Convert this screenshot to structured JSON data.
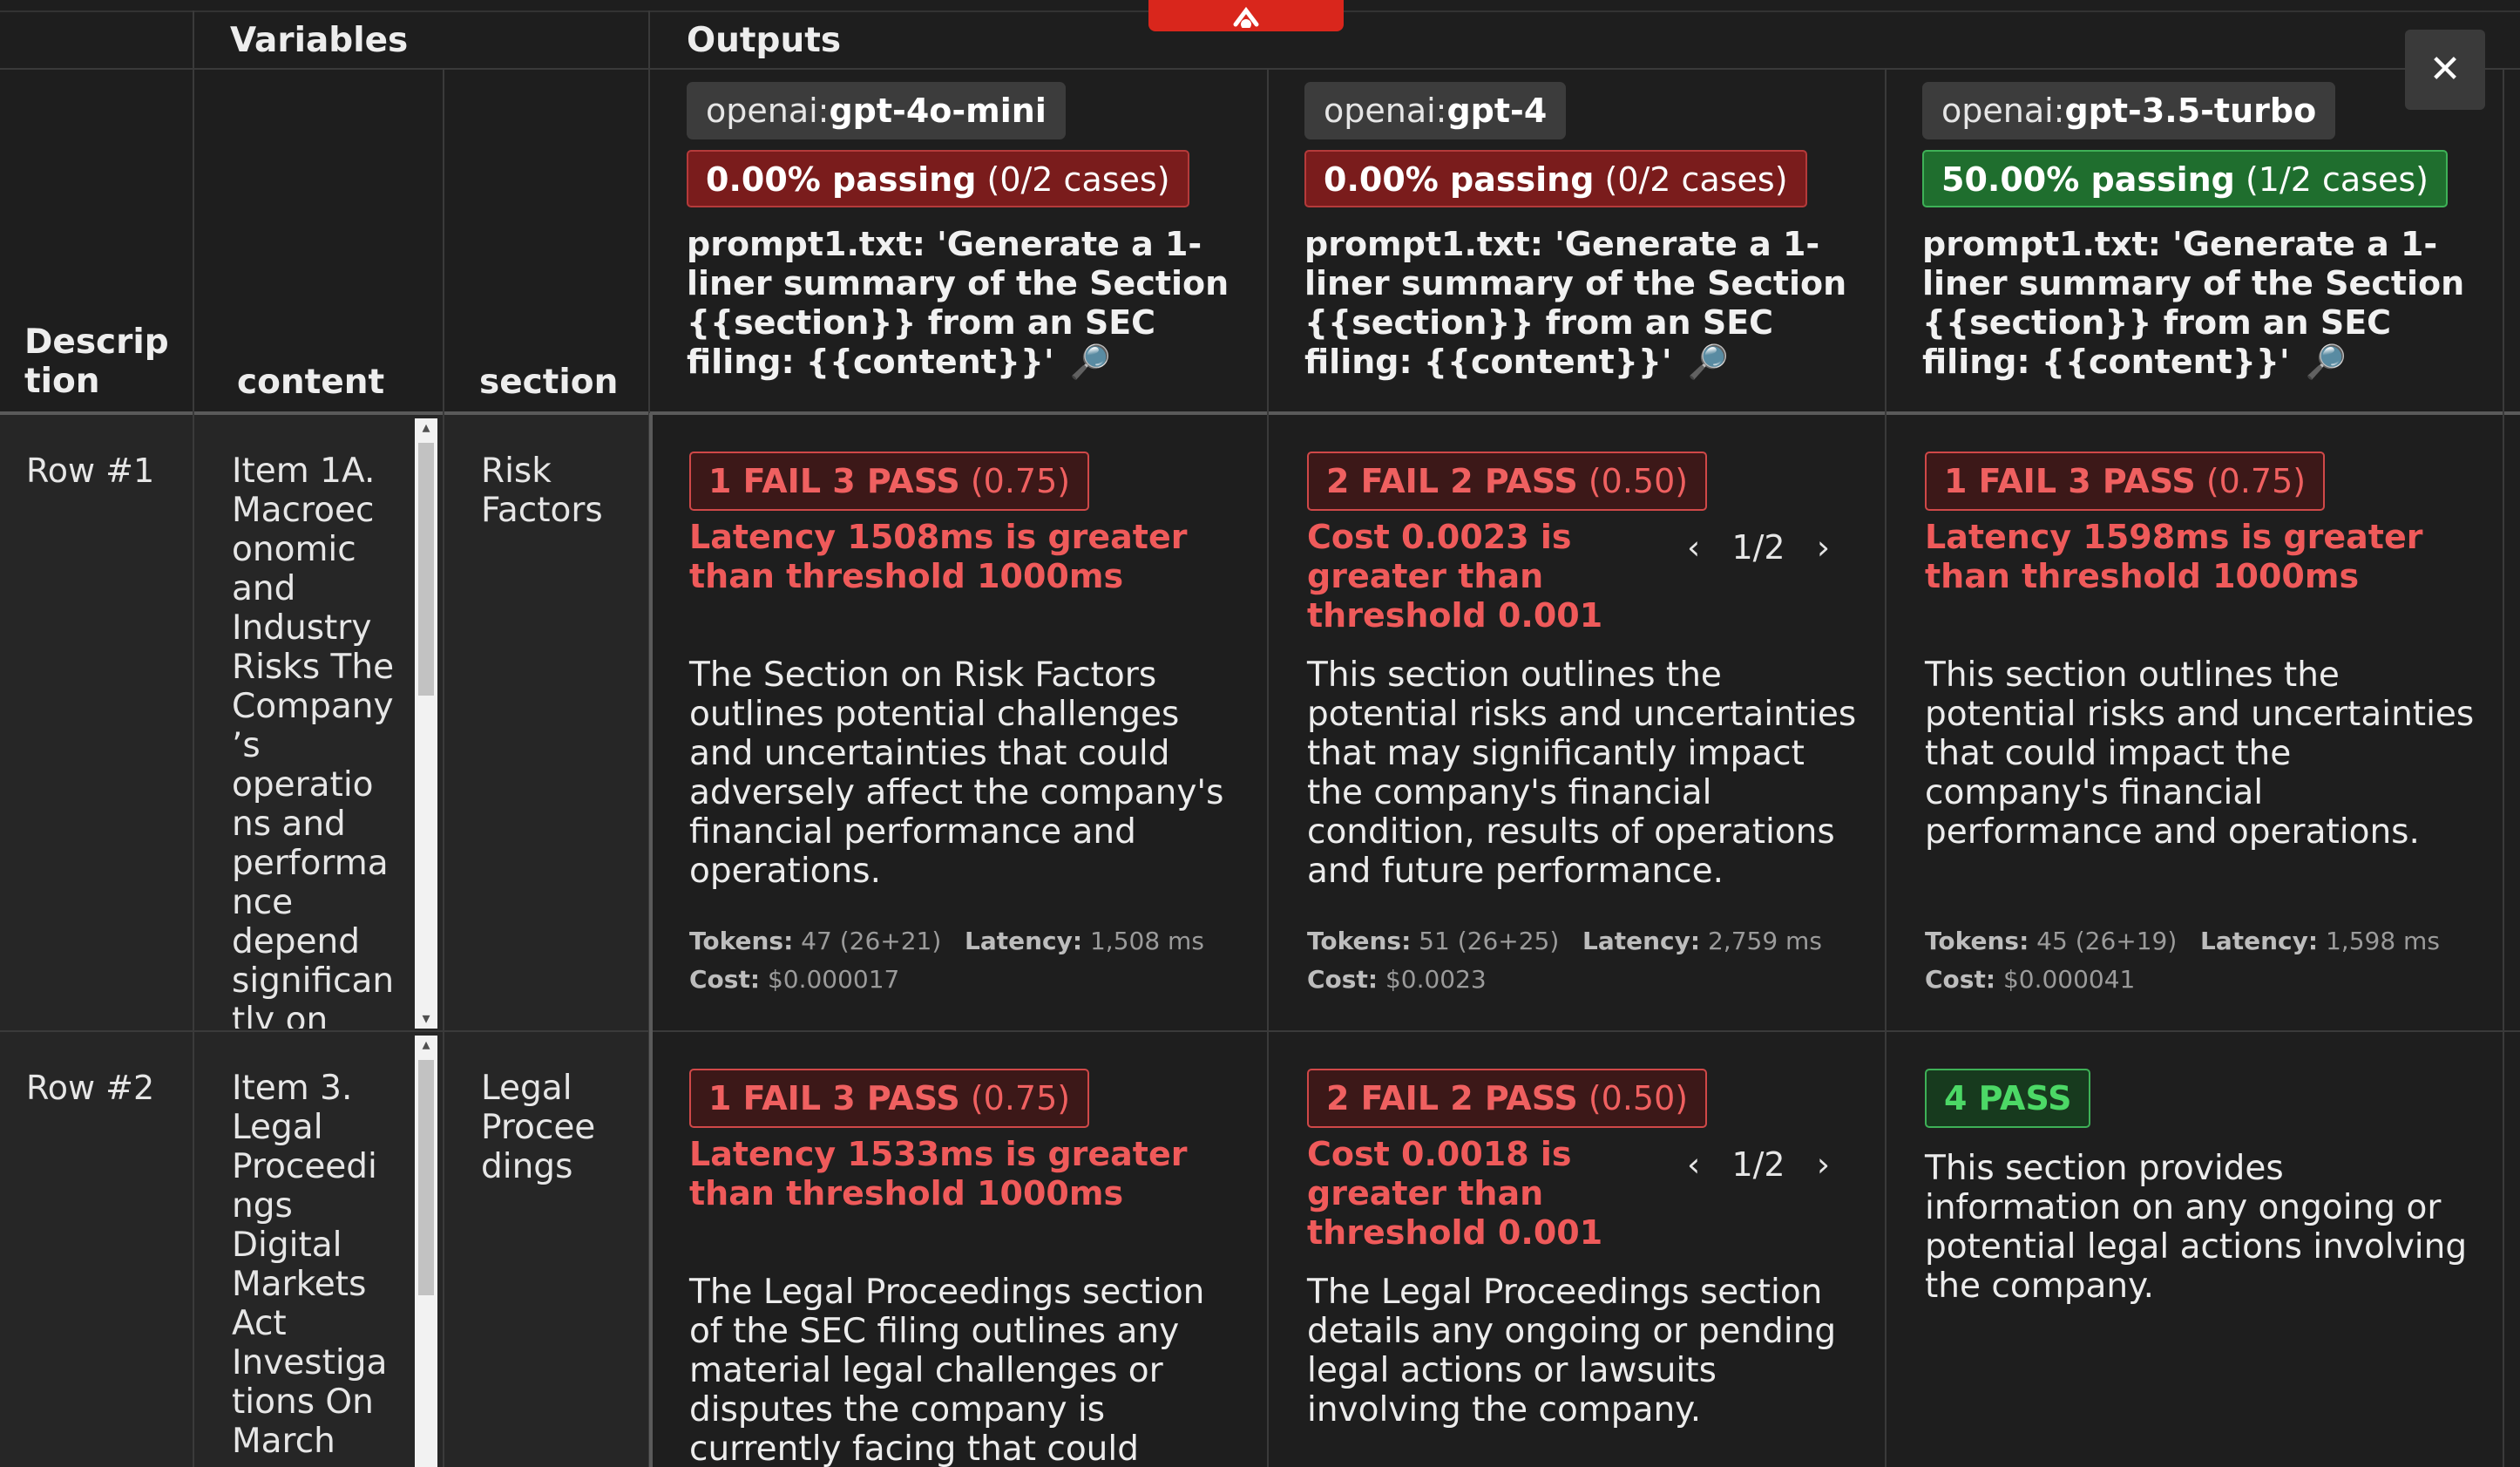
{
  "header": {
    "variables_label": "Variables",
    "outputs_label": "Outputs",
    "columns": {
      "description": "Descrip\ntion",
      "content": "content",
      "section": "section"
    }
  },
  "close_label": "✕",
  "providers": [
    {
      "prefix": "openai:",
      "model": "gpt-4o-mini",
      "pass_pct": "0.00% passing",
      "pass_cases": " (0/2 cases)",
      "pass_status": "red",
      "prompt": "prompt1.txt: 'Generate a 1-liner summary of the Section {{section}} from an SEC filing: {{content}}'",
      "magnifier": "🔎"
    },
    {
      "prefix": "openai:",
      "model": "gpt-4",
      "pass_pct": "0.00% passing",
      "pass_cases": " (0/2 cases)",
      "pass_status": "red",
      "prompt": "prompt1.txt: 'Generate a 1-liner summary of the Section {{section}} from an SEC filing: {{content}}'",
      "magnifier": "🔎"
    },
    {
      "prefix": "openai:",
      "model": "gpt-3.5-turbo",
      "pass_pct": "50.00% passing",
      "pass_cases": " (1/2 cases)",
      "pass_status": "green",
      "prompt": "prompt1.txt: 'Generate a 1-liner summary of the Section {{section}} from an SEC filing: {{content}}'",
      "magnifier": "🔎"
    }
  ],
  "rows": [
    {
      "label": "Row #1",
      "content": "Item 1A.\nMacroec\nonomic\nand\nIndustry\nRisks The\nCompany\n’s\noperatio\nns and\nperforma\nnce\ndepend\nsignifican\ntly on",
      "section": "Risk\nFactors",
      "cells": [
        {
          "badge_main": "1 FAIL 3 PASS",
          "badge_score": " (0.75)",
          "reason": "Latency 1508ms is greater than threshold 1000ms",
          "text": "The Section on Risk Factors outlines potential challenges and uncertainties that could adversely affect the company's financial performance and operations.",
          "tokens_label": "Tokens:",
          "tokens": " 47 (26+21)",
          "latency_label": "Latency:",
          "latency": " 1,508 ms",
          "cost_label": "Cost:",
          "cost": " $0.000017"
        },
        {
          "badge_main": "2 FAIL 2 PASS",
          "badge_score": " (0.50)",
          "reason": "Cost 0.0023 is greater than threshold 0.001",
          "pager_prev": "‹",
          "pager": "1/2",
          "pager_next": "›",
          "text": "This section outlines the potential risks and uncertainties that may significantly impact the company's financial condition, results of operations and future performance.",
          "tokens_label": "Tokens:",
          "tokens": " 51 (26+25)",
          "latency_label": "Latency:",
          "latency": " 2,759 ms",
          "cost_label": "Cost:",
          "cost": " $0.0023"
        },
        {
          "badge_main": "1 FAIL 3 PASS",
          "badge_score": " (0.75)",
          "reason": "Latency 1598ms is greater than threshold 1000ms",
          "text": "This section outlines the potential risks and uncertainties that could impact the company's financial performance and operations.",
          "tokens_label": "Tokens:",
          "tokens": " 45 (26+19)",
          "latency_label": "Latency:",
          "latency": " 1,598 ms",
          "cost_label": "Cost:",
          "cost": " $0.000041"
        }
      ]
    },
    {
      "label": "Row #2",
      "content": "Item 3.\nLegal\nProceedi\nngs\nDigital\nMarkets\nAct\nInvestiga\ntions On\nMarch",
      "section": "Legal\nProcee\ndings",
      "cells": [
        {
          "badge_main": "1 FAIL 3 PASS",
          "badge_score": " (0.75)",
          "reason": "Latency 1533ms is greater than threshold 1000ms",
          "text": "The Legal Proceedings section of the SEC filing outlines any material legal challenges or disputes the company is currently facing that could impact its financial position"
        },
        {
          "badge_main": "2 FAIL 2 PASS",
          "badge_score": " (0.50)",
          "reason": "Cost 0.0018 is greater than threshold 0.001",
          "pager_prev": "‹",
          "pager": "1/2",
          "pager_next": "›",
          "text": "The Legal Proceedings section details any ongoing or pending legal actions or lawsuits involving the company."
        },
        {
          "badge_main": "4 PASS",
          "text": "This section provides information on any ongoing or potential legal actions involving the company."
        }
      ]
    }
  ],
  "colors": {
    "fail_red": "#ef5a5a",
    "pass_green": "#4cd866",
    "toggle_red": "#d9261c"
  }
}
